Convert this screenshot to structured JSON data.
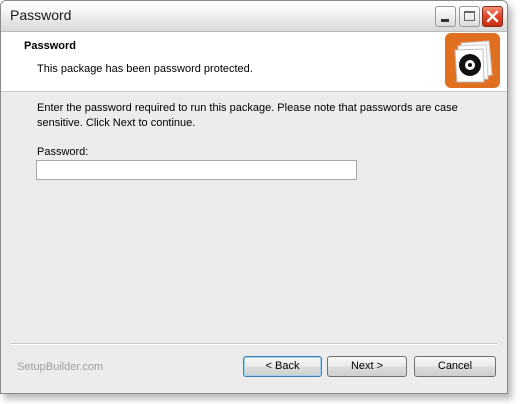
{
  "window": {
    "title": "Password",
    "controls": {
      "minimize_icon": "minimize-icon",
      "maximize_icon": "maximize-icon",
      "close_icon": "close-icon"
    }
  },
  "header": {
    "title": "Password",
    "subtitle": "This package has been password protected.",
    "logo_icon": "disc-package-icon",
    "logo_color": "#e07020"
  },
  "body": {
    "instructions": "Enter the password required to run this package. Please note that passwords are case sensitive. Click Next to continue.",
    "password_label": "Password:",
    "password_value": "",
    "password_placeholder": ""
  },
  "footer": {
    "brand": "SetupBuilder.com",
    "back_label": "< Back",
    "next_label": "Next >",
    "cancel_label": "Cancel"
  }
}
